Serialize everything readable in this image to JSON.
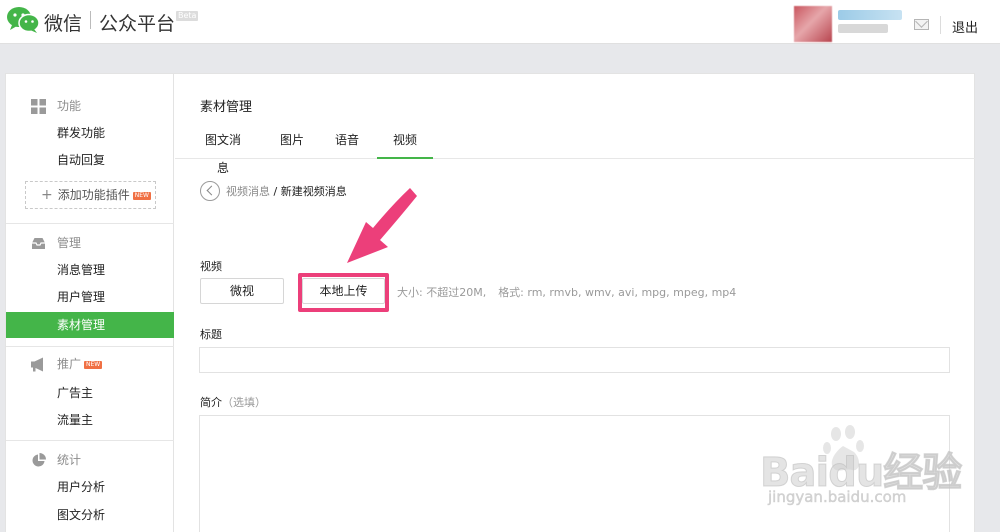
{
  "header": {
    "brand_name": "微信",
    "product_name": "公众平台",
    "beta_label": "Beta",
    "logout_label": "退出"
  },
  "sidebar": {
    "sections": [
      {
        "label": "功能",
        "icon": "grid-icon",
        "items": [
          "群发功能",
          "自动回复"
        ]
      },
      {
        "label": "管理",
        "icon": "inbox-icon",
        "items": [
          "消息管理",
          "用户管理",
          "素材管理"
        ]
      },
      {
        "label": "推广",
        "icon": "megaphone-icon",
        "badge": "NEW",
        "items": [
          "广告主",
          "流量主"
        ]
      },
      {
        "label": "统计",
        "icon": "pie-chart-icon",
        "items": [
          "用户分析",
          "图文分析"
        ]
      }
    ],
    "add_plugin_label": "添加功能插件",
    "add_plugin_badge": "NEW",
    "active_item": "素材管理"
  },
  "main": {
    "title": "素材管理",
    "tabs": [
      {
        "label": "图文消息",
        "active": false
      },
      {
        "label": "图片",
        "active": false
      },
      {
        "label": "语音",
        "active": false
      },
      {
        "label": "视频",
        "active": true
      }
    ],
    "breadcrumb": {
      "parent": "视频消息",
      "separator": " / ",
      "current": "新建视频消息"
    },
    "video_label": "视频",
    "source_buttons": [
      "微视",
      "本地上传"
    ],
    "upload_hint_size": "大小: 不超过20M,",
    "upload_hint_format": "格式: rm, rmvb, wmv, avi, mpg, mpeg, mp4",
    "title_label": "标题",
    "title_value": "",
    "intro_label": "简介",
    "intro_optional": "（选填）",
    "intro_value": ""
  },
  "annotation": {
    "color": "#ec3f7a"
  },
  "watermark": {
    "brand": "Baidu经验",
    "url": "jingyan.baidu.com"
  },
  "colors": {
    "accent": "#44b549",
    "badge": "#f07044"
  }
}
